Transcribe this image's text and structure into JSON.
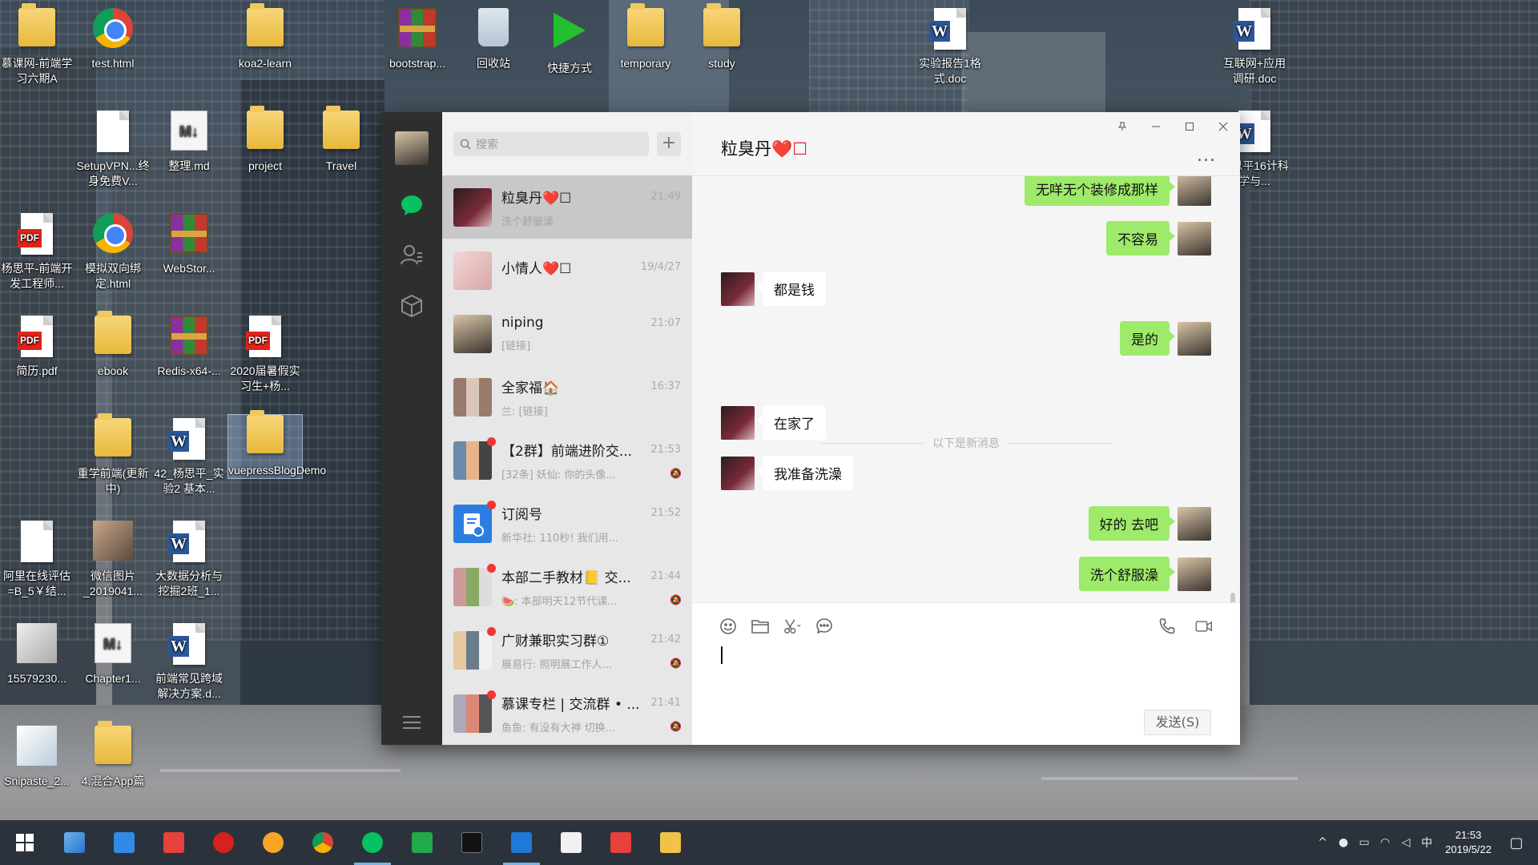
{
  "desktop": {
    "icons": [
      {
        "label": "慕课网-前端学习六期A"
      },
      {
        "label": "test.html"
      },
      {
        "label": "koa2-learn"
      },
      {
        "label": "bootstrap..."
      },
      {
        "label": "回收站"
      },
      {
        "label": "快捷方式"
      },
      {
        "label": "temporary"
      },
      {
        "label": "study"
      },
      {
        "label": "实验报告1格式.doc"
      },
      {
        "label": "互联网+应用调研.doc"
      },
      {
        "label": "SetupVPN...终身免费V..."
      },
      {
        "label": "整理.md"
      },
      {
        "label": "project"
      },
      {
        "label": "Travel"
      },
      {
        "label": "杨思平16计科学与..."
      },
      {
        "label": "杨思平-前端开发工程师..."
      },
      {
        "label": "模拟双向绑定.html"
      },
      {
        "label": "WebStor..."
      },
      {
        "label": "简历.pdf"
      },
      {
        "label": "ebook"
      },
      {
        "label": "Redis-x64-..."
      },
      {
        "label": "2020届暑假实习生+杨..."
      },
      {
        "label": "重学前端(更新中)"
      },
      {
        "label": "42_杨思平_实验2 基本..."
      },
      {
        "label": "vuepressBlogDemo"
      },
      {
        "label": "阿里在线评估=B_5￥结..."
      },
      {
        "label": "微信图片_2019041..."
      },
      {
        "label": "大数据分析与挖掘2班_1..."
      },
      {
        "label": "15579230..."
      },
      {
        "label": "Chapter1..."
      },
      {
        "label": "前端常见跨域解决方案.d..."
      },
      {
        "label": "Snipaste_2..."
      },
      {
        "label": "4.混合App篇"
      }
    ]
  },
  "wechat": {
    "search_placeholder": "搜索",
    "add_label": "+",
    "chats": [
      {
        "name": "粒臭丹❤️☐",
        "time": "21:49",
        "preview": "洗个舒服澡",
        "unread": false,
        "muted": false
      },
      {
        "name": "小情人❤️☐",
        "time": "19/4/27",
        "preview": "",
        "unread": false,
        "muted": false
      },
      {
        "name": "niping",
        "time": "21:07",
        "preview": "[链接]",
        "unread": false,
        "muted": false
      },
      {
        "name": "全家福🏠",
        "time": "16:37",
        "preview": "兰: [链接]",
        "unread": false,
        "muted": false
      },
      {
        "name": "【2群】前端进阶交...",
        "time": "21:53",
        "preview": "[32条] 妖仙: 你的头像...",
        "unread": true,
        "muted": true
      },
      {
        "name": "订阅号",
        "time": "21:52",
        "preview": "新华社: 110秒! 我们用...",
        "unread": true,
        "muted": false
      },
      {
        "name": "本部二手教材📒 交...",
        "time": "21:44",
        "preview": "🍉: 本部明天12节代课...",
        "unread": true,
        "muted": true
      },
      {
        "name": "广财兼职实习群①",
        "time": "21:42",
        "preview": "展易行: 照明展工作人...",
        "unread": true,
        "muted": true
      },
      {
        "name": "慕课专栏 | 交流群 • ...",
        "time": "21:41",
        "preview": "鱼鱼: 有没有大神  切换...",
        "unread": true,
        "muted": true
      }
    ],
    "chat_title": "粒臭丹",
    "chat_title_suffix": "❤️☐",
    "more_label": "...",
    "messages": [
      {
        "side": "right",
        "text": "无咩无个装修成那样"
      },
      {
        "side": "right",
        "text": "不容易"
      },
      {
        "side": "left",
        "text": "都是钱"
      },
      {
        "side": "right",
        "text": "是的"
      },
      {
        "side": "left",
        "text": "在家了"
      },
      {
        "side": "left",
        "text": "我准备洗澡"
      },
      {
        "side": "right",
        "text": "好的 去吧"
      },
      {
        "side": "right",
        "text": "洗个舒服澡"
      }
    ],
    "new_message_divider": "以下是新消息",
    "send_label": "发送(S)"
  },
  "taskbar": {
    "clock_time": "21:53",
    "clock_date": "2019/5/22",
    "ime": "中"
  },
  "colors": {
    "wechat_green": "#9eea6a",
    "sidebar_dark": "#2e2e2e",
    "chat_icon_green": "#07c160",
    "unread_red": "#f43530"
  }
}
